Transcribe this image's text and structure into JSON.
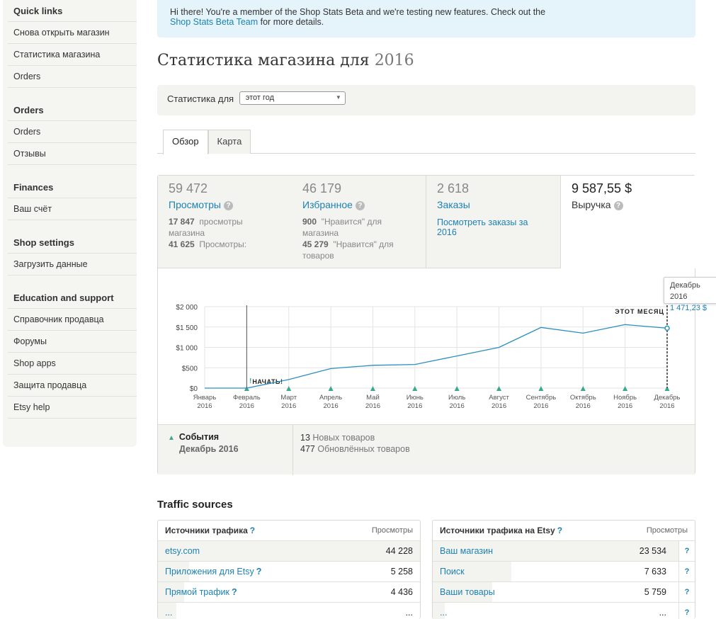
{
  "sidebar": {
    "sections": [
      {
        "title": "Quick links",
        "items": [
          "Снова открыть магазин",
          "Статистика магазина",
          "Orders"
        ]
      },
      {
        "title": "Orders",
        "items": [
          "Orders",
          "Отзывы"
        ]
      },
      {
        "title": "Finances",
        "items": [
          "Ваш счёт"
        ]
      },
      {
        "title": "Shop settings",
        "items": [
          "Загрузить данные"
        ]
      },
      {
        "title": "Education and support",
        "items": [
          "Справочник продавца",
          "Форумы",
          "Shop apps",
          "Защита продавца",
          "Etsy help"
        ]
      }
    ]
  },
  "banner": {
    "text_before": "Hi there! You're a member of the Shop Stats Beta and we're testing new features. Check out the",
    "link": "Shop Stats Beta Team",
    "text_after": " for more details."
  },
  "page": {
    "title": "Статистика магазина для",
    "year": "2016",
    "filter_label": "Статистика для",
    "filter_value": "этот год"
  },
  "tabs": [
    "Обзор",
    "Карта"
  ],
  "metrics": {
    "views": {
      "value": "59 472",
      "label": "Просмотры",
      "sub1_num": "17 847",
      "sub1_text": "просмотры магазина",
      "sub2_num": "41 625",
      "sub2_text": "Просмотры:"
    },
    "favorites": {
      "value": "46 179",
      "label": "Избранное",
      "sub1_num": "900",
      "sub1_text": "\"Нравится\" для магазина",
      "sub2_num": "45 279",
      "sub2_text": "\"Нравится\" для товаров"
    },
    "orders": {
      "value": "2 618",
      "label": "Заказы",
      "link": "Посмотреть заказы за 2016"
    },
    "revenue": {
      "value": "9 587,55 $",
      "label": "Выручка"
    }
  },
  "chart_data": {
    "type": "line",
    "categories": [
      "Январь 2016",
      "Февраль 2016",
      "Март 2016",
      "Апрель 2016",
      "Май 2016",
      "Июнь 2016",
      "Июль 2016",
      "Август 2016",
      "Сентябрь 2016",
      "Октябрь 2016",
      "Ноябрь 2016",
      "Декабрь 2016"
    ],
    "values": [
      0,
      0,
      210,
      480,
      560,
      580,
      790,
      1000,
      1490,
      1350,
      1560,
      1471.23
    ],
    "ylim": [
      0,
      2000
    ],
    "yticks": [
      "$0",
      "$500",
      "$1 000",
      "$1 500",
      "$2 000"
    ],
    "annotations": {
      "start": "НАЧАТЬ!",
      "start_mark": "!",
      "current": "ЭТОТ МЕСЯЦ"
    },
    "tooltip": {
      "label": "Декабрь 2016",
      "value": "1 471,23 $"
    },
    "line_color": "#2a8fbf"
  },
  "events": {
    "title": "События",
    "period": "Декабрь 2016",
    "new_count": "13",
    "new_text": "Новых товаров",
    "updated_count": "477",
    "updated_text": "Обновлённых товаров"
  },
  "traffic": {
    "title": "Traffic sources",
    "left": {
      "header": "Источники трафика",
      "column": "Просмотры",
      "rows": [
        {
          "name": "etsy.com",
          "value": "44 228",
          "bar": 1.0
        },
        {
          "name": "Приложения для Etsy",
          "value": "5 258",
          "bar": 0.12,
          "q": true
        },
        {
          "name": "Прямой трафик",
          "value": "4 436",
          "bar": 0.1,
          "q": true
        },
        {
          "name": "...",
          "value": "...",
          "bar": 0.07
        }
      ]
    },
    "right": {
      "header": "Источники трафика на Etsy",
      "column": "Просмотры",
      "rows": [
        {
          "name": "Ваш магазин",
          "value": "23 534",
          "bar": 1.0
        },
        {
          "name": "Поиск",
          "value": "7 633",
          "bar": 0.32
        },
        {
          "name": "Ваши товары",
          "value": "5 759",
          "bar": 0.24
        },
        {
          "name": "...",
          "value": "...",
          "bar": 0.05
        }
      ]
    }
  }
}
